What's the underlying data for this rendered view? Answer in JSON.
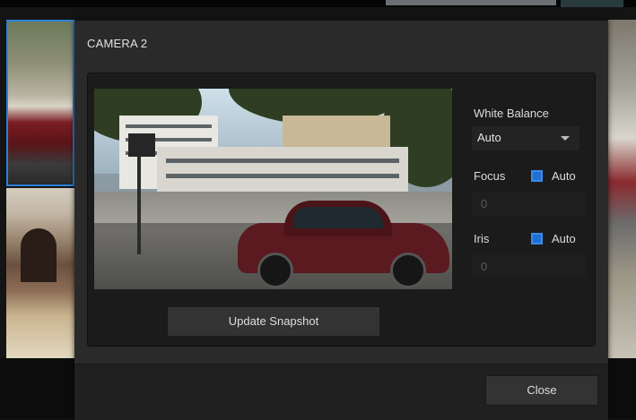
{
  "dialog": {
    "title": "CAMERA 2"
  },
  "white_balance": {
    "label": "White Balance",
    "value": "Auto"
  },
  "focus": {
    "label": "Focus",
    "auto_label": "Auto",
    "auto_checked": true,
    "value": "0"
  },
  "iris": {
    "label": "Iris",
    "auto_label": "Auto",
    "auto_checked": true,
    "value": "0"
  },
  "buttons": {
    "update_snapshot": "Update Snapshot",
    "close": "Close"
  },
  "colors": {
    "accent": "#1f6fd4",
    "dialog_bg": "#2a2a2a",
    "panel_bg": "#1b1b1b"
  }
}
